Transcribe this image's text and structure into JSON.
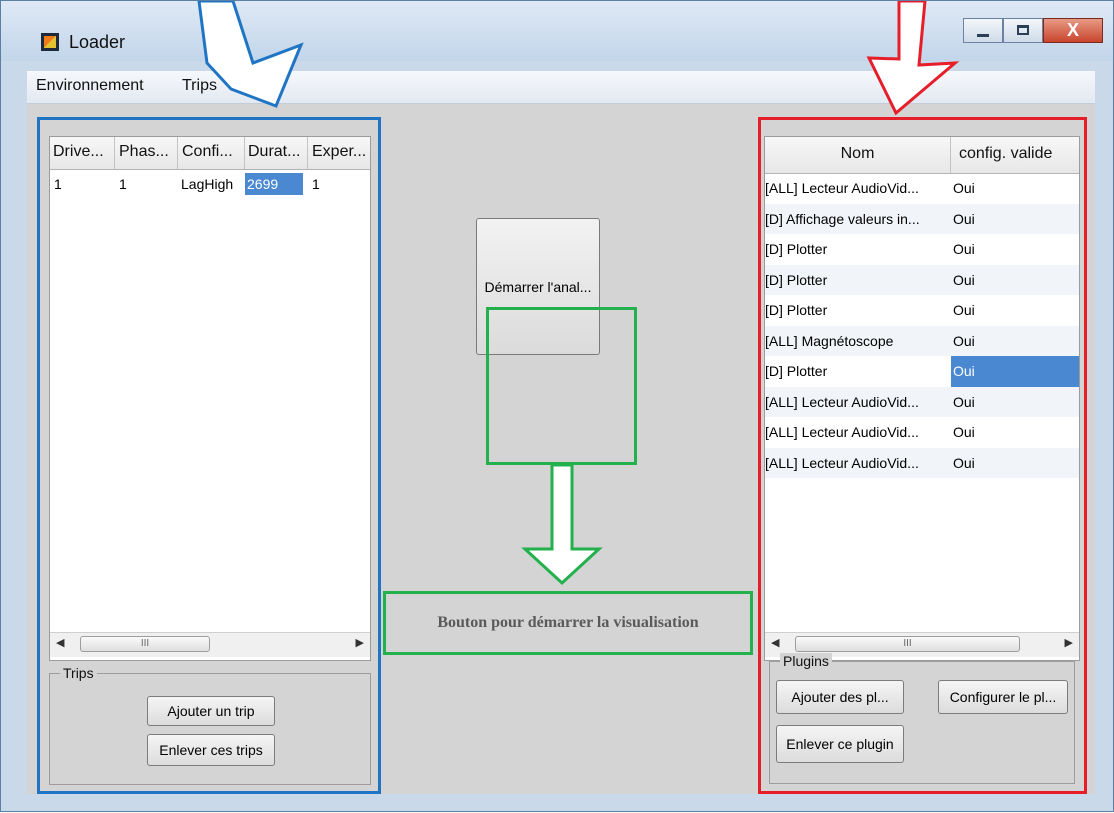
{
  "window": {
    "title": "Loader",
    "close_glyph": "X"
  },
  "menu": {
    "items": [
      "Environnement",
      "Trips"
    ]
  },
  "trips_table": {
    "columns": [
      "Drive...",
      "Phas...",
      "Confi...",
      "Durat...",
      "Exper..."
    ],
    "rows": [
      [
        "1",
        "1",
        "LagHigh",
        "2699",
        "1"
      ]
    ],
    "selected_cell": "2699",
    "scroll_thumb_glyph": "III"
  },
  "trips_group": {
    "title": "Trips",
    "add_label": "Ajouter un trip",
    "remove_label": "Enlever ces trips"
  },
  "start_button": {
    "label": "Démarrer l'anal..."
  },
  "caption": {
    "text": "Bouton pour démarrer la visualisation"
  },
  "plugins_table": {
    "columns": [
      "Nom",
      "config. valide"
    ],
    "rows": [
      [
        "[ALL] Lecteur AudioVid...",
        "Oui"
      ],
      [
        "[D] Affichage valeurs in...",
        "Oui"
      ],
      [
        "[D] Plotter",
        "Oui"
      ],
      [
        "[D] Plotter",
        "Oui"
      ],
      [
        "[D] Plotter",
        "Oui"
      ],
      [
        "[ALL] Magnétoscope",
        "Oui"
      ],
      [
        "[D] Plotter",
        "Oui"
      ],
      [
        "[ALL] Lecteur AudioVid...",
        "Oui"
      ],
      [
        "[ALL] Lecteur AudioVid...",
        "Oui"
      ],
      [
        "[ALL] Lecteur AudioVid...",
        "Oui"
      ]
    ],
    "selected_row": 6,
    "scroll_thumb_glyph": "III"
  },
  "plugins_group": {
    "title": "Plugins",
    "add_label": "Ajouter des pl...",
    "configure_label": "Configurer le pl...",
    "remove_label": "Enlever ce plugin"
  },
  "colors": {
    "annotation_blue": "#1f75c4",
    "annotation_red": "#e51e2a",
    "annotation_green": "#22b14c",
    "selection": "#4a88d2"
  }
}
